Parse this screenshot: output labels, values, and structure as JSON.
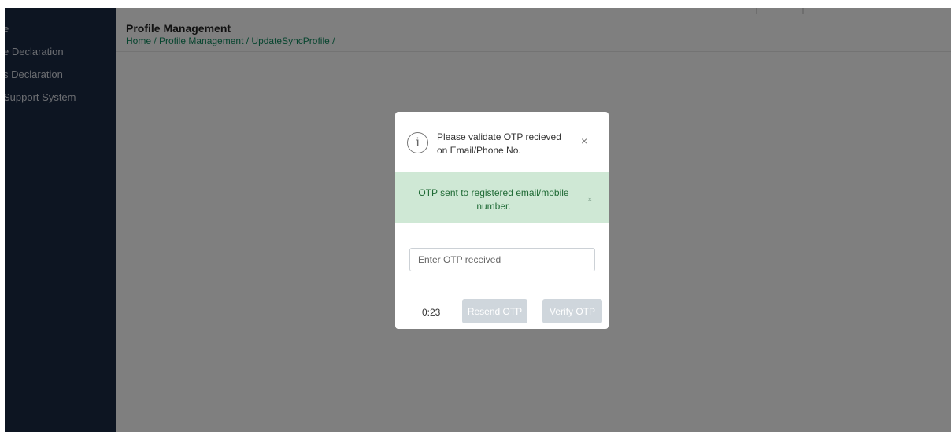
{
  "sidebar": {
    "items": [
      {
        "label": "e"
      },
      {
        "label": "e Declaration"
      },
      {
        "label": "s Declaration"
      },
      {
        "label": " Support System"
      }
    ]
  },
  "header": {
    "title": "Profile Management",
    "breadcrumb": "Home / Profile Management / UpdateSyncProfile /"
  },
  "modal": {
    "message": "Please validate OTP recieved on Email/Phone No.",
    "close": "×",
    "alert": {
      "text": "OTP sent to registered email/mobile number.",
      "close": "×"
    },
    "otp_input": {
      "placeholder": "Enter OTP received",
      "value": ""
    },
    "timer": "0:23",
    "resend_label": "Resend OTP",
    "verify_label": "Verify OTP"
  },
  "colors": {
    "sidebar_bg": "#1b2a45",
    "breadcrumb": "#0f8a5f",
    "alert_bg": "#cfe8d5",
    "alert_text": "#1f6a35",
    "disabled_button": "#cfd6dc"
  },
  "icons": {
    "info": "info-circle-icon",
    "close": "close-icon"
  }
}
